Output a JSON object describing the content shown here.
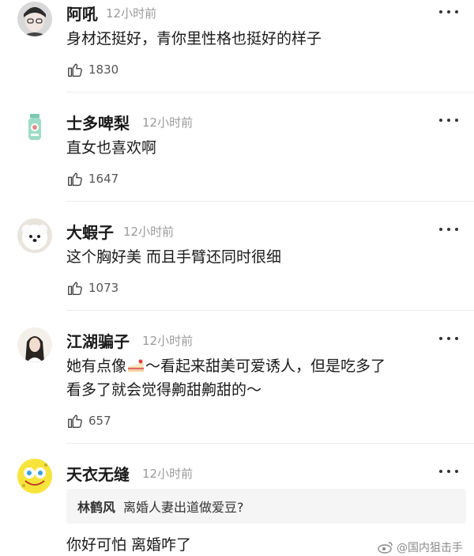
{
  "comments": [
    {
      "user": "阿吼",
      "time": "12小时前",
      "text": "身材还挺好，青你里性格也挺好的样子",
      "likes": "1830",
      "avatar": "boy-glasses-avatar"
    },
    {
      "user": "士多啤梨",
      "time": "12小时前",
      "text": "直女也喜欢啊",
      "likes": "1647",
      "avatar": "bottle-avatar"
    },
    {
      "user": "大蝦子",
      "time": "12小时前",
      "text": "这个胸好美 而且手臂还同时很细",
      "likes": "1073",
      "avatar": "pomeranian-avatar"
    },
    {
      "user": "江湖骗子",
      "time": "12小时前",
      "text_line1_before": "她有点像",
      "text_line1_after": "～看起来甜美可爱诱人，但是吃多了",
      "text_line2": "看多了就会觉得齁甜齁甜的～",
      "likes": "657",
      "avatar": "girl-long-hair-avatar"
    },
    {
      "user": "天衣无缝",
      "time": "12小时前",
      "quote_user": "林鹤风",
      "quote_text": "离婚人妻出道做爱豆?",
      "text": "你好可怕 离婚咋了",
      "avatar": "spongebob-avatar"
    }
  ],
  "watermark": "@国内狙击手",
  "colors": {
    "text": "#1a1a1a",
    "meta": "#9a9a9a",
    "quote_bg": "#f5f5f5"
  }
}
